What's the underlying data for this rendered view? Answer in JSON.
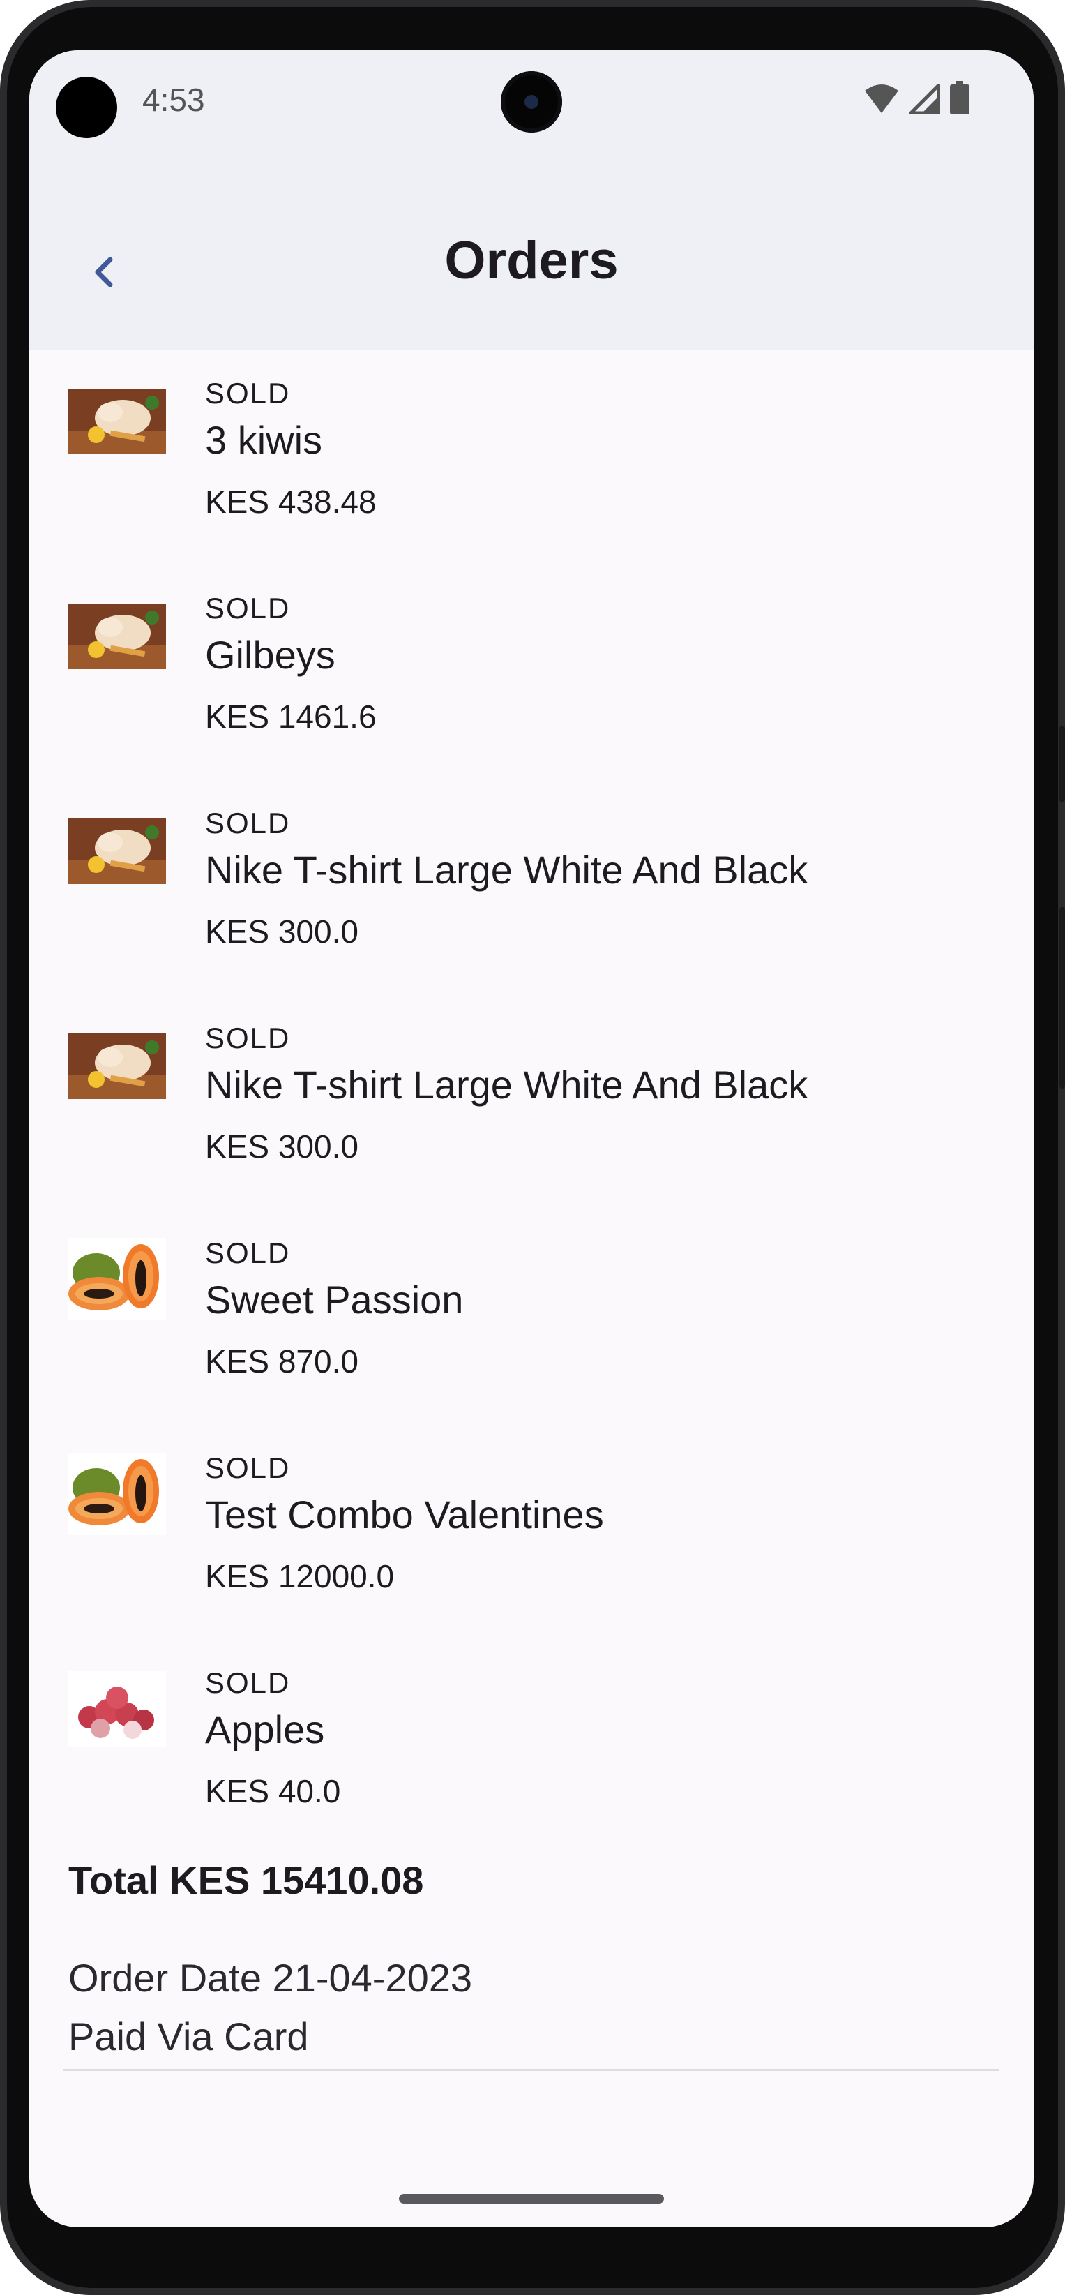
{
  "status_bar": {
    "time": "4:53",
    "icons": [
      "wifi-icon",
      "cellular-signal-icon",
      "battery-icon"
    ]
  },
  "app_bar": {
    "title": "Orders",
    "back_icon": "chevron-left-icon"
  },
  "orders": [
    {
      "status": "SOLD",
      "name": "3 kiwis",
      "price": "KES 438.48",
      "image": "chicken-image"
    },
    {
      "status": "SOLD",
      "name": "Gilbeys",
      "price": "KES 1461.6",
      "image": "chicken-image"
    },
    {
      "status": "SOLD",
      "name": "Nike T-shirt Large White And Black",
      "price": "KES 300.0",
      "image": "chicken-image"
    },
    {
      "status": "SOLD",
      "name": "Nike T-shirt Large White And Black",
      "price": "KES 300.0",
      "image": "chicken-image"
    },
    {
      "status": "SOLD",
      "name": "Sweet Passion",
      "price": "KES 870.0",
      "image": "papaya-image"
    },
    {
      "status": "SOLD",
      "name": "Test Combo Valentines",
      "price": "KES 12000.0",
      "image": "papaya-image"
    },
    {
      "status": "SOLD",
      "name": "Apples",
      "price": "KES 40.0",
      "image": "lychee-image"
    }
  ],
  "summary": {
    "total": "Total KES 15410.08",
    "order_date": "Order Date 21-04-2023",
    "payment": "Paid Via Card"
  },
  "colors": {
    "app_bar_bg": "#efeff6",
    "screen_bg": "#fcf9fc",
    "text": "#1d1b20",
    "back_icon": "#3f5a96"
  }
}
